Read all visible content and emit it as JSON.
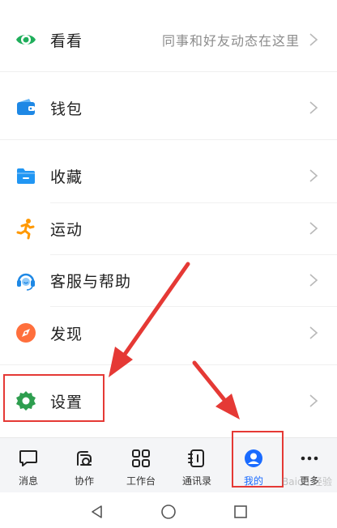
{
  "menu": {
    "items": [
      {
        "label": "看看",
        "hint": "同事和好友动态在这里",
        "icon": "eye-icon"
      },
      {
        "label": "钱包",
        "hint": "",
        "icon": "wallet-icon"
      },
      {
        "label": "收藏",
        "hint": "",
        "icon": "folder-icon"
      },
      {
        "label": "运动",
        "hint": "",
        "icon": "running-person-icon"
      },
      {
        "label": "客服与帮助",
        "hint": "",
        "icon": "headset-icon"
      },
      {
        "label": "发现",
        "hint": "",
        "icon": "compass-icon"
      },
      {
        "label": "设置",
        "hint": "",
        "icon": "gear-icon"
      }
    ]
  },
  "tabbar": {
    "tabs": [
      {
        "label": "消息",
        "icon": "chat-bubble-icon",
        "active": false
      },
      {
        "label": "协作",
        "icon": "collaborate-icon",
        "active": false
      },
      {
        "label": "工作台",
        "icon": "grid-icon",
        "active": false
      },
      {
        "label": "通讯录",
        "icon": "contacts-book-icon",
        "active": false
      },
      {
        "label": "我的",
        "icon": "person-icon",
        "active": true
      },
      {
        "label": "更多",
        "icon": "more-dots-icon",
        "active": false
      }
    ]
  },
  "colors": {
    "accent": "#1a6bff",
    "annotation": "#e53935",
    "eye": "#1fae5b",
    "wallet": "#1e88e5",
    "folder": "#2196f3",
    "running": "#ff9800",
    "headset": "#1e88e5",
    "compass": "#ff6f3c",
    "gear": "#2e9e4f"
  },
  "watermark": "Baidu 经验"
}
